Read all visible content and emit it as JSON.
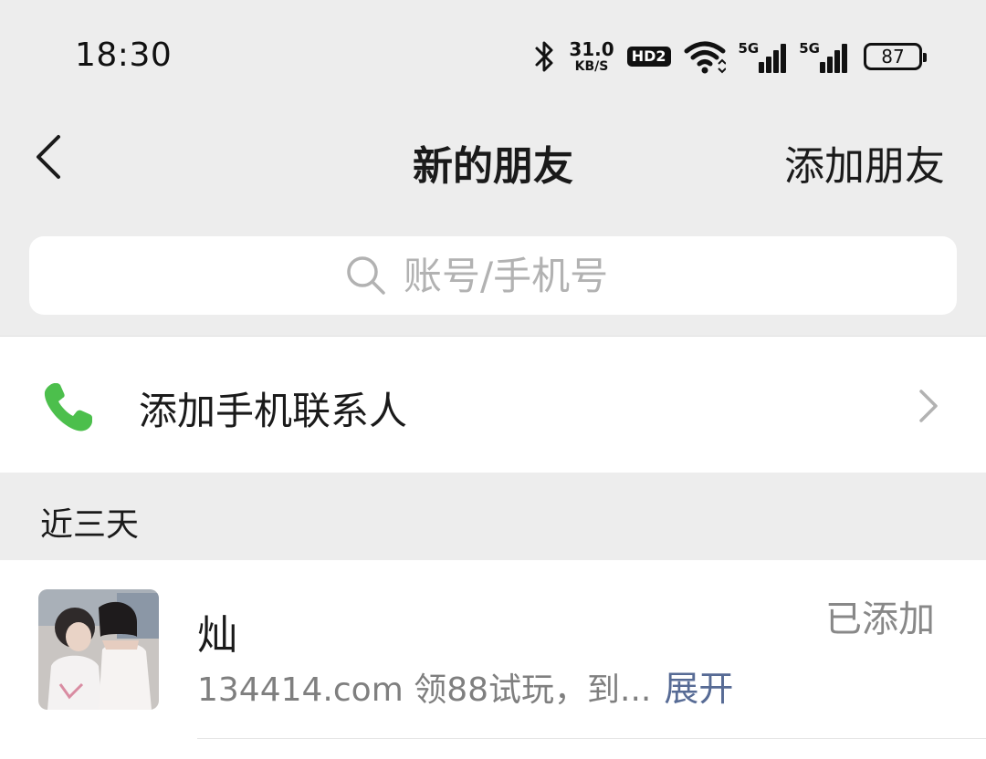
{
  "status_bar": {
    "time": "18:30",
    "net_speed": "31.0",
    "net_unit": "KB/S",
    "hd_label": "HD2",
    "signal1_label": "5G",
    "signal2_label": "5G",
    "battery": "87"
  },
  "nav": {
    "title": "新的朋友",
    "add_friend": "添加朋友"
  },
  "search": {
    "placeholder": "账号/手机号"
  },
  "contacts_row": {
    "label": "添加手机联系人",
    "icon": "phone-icon",
    "icon_color": "#4cbf4c"
  },
  "section": {
    "title": "近三天"
  },
  "friends": [
    {
      "name": "灿",
      "message": "134414.com 领88试玩，到...",
      "expand": "展开",
      "status": "已添加"
    }
  ],
  "colors": {
    "background": "#ededed",
    "link": "#576b95",
    "accent_green": "#4cbf4c"
  }
}
